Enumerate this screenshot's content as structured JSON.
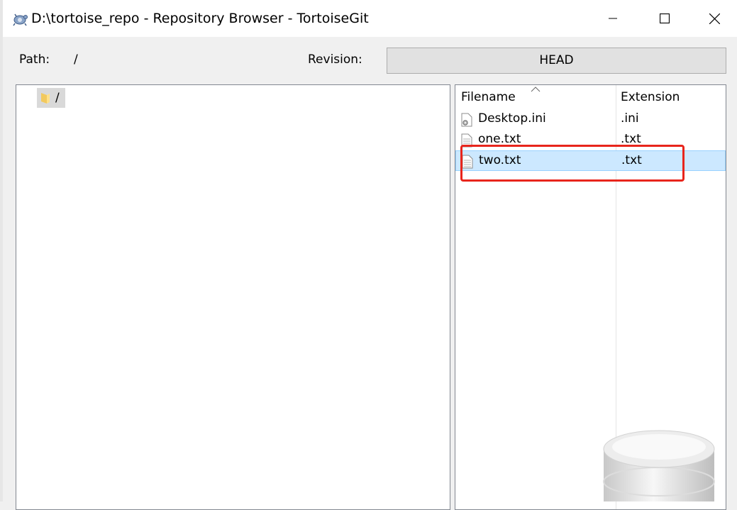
{
  "window": {
    "title": "D:\\tortoise_repo - Repository Browser - TortoiseGit",
    "icon": "tortoisegit-icon",
    "controls": [
      "minimize-icon",
      "maximize-icon",
      "close-icon"
    ]
  },
  "toolbar": {
    "path_label": "Path:",
    "path_value": "/",
    "revision_label": "Revision:",
    "revision_value": "HEAD"
  },
  "tree": {
    "nodes": [
      {
        "label": "/",
        "icon": "folder-icon"
      }
    ]
  },
  "file_list": {
    "columns": [
      {
        "label": "Filename",
        "sorted": "ascending"
      },
      {
        "label": "Extension"
      }
    ],
    "rows": [
      {
        "name": "Desktop.ini",
        "ext": ".ini",
        "icon": "settings-file-icon"
      },
      {
        "name": "one.txt",
        "ext": ".txt",
        "icon": "text-file-icon"
      },
      {
        "name": "two.txt",
        "ext": ".txt",
        "icon": "text-file-icon",
        "selected": true
      }
    ]
  },
  "colors": {
    "highlight": "#e8251c",
    "selection": "#cce8ff"
  }
}
